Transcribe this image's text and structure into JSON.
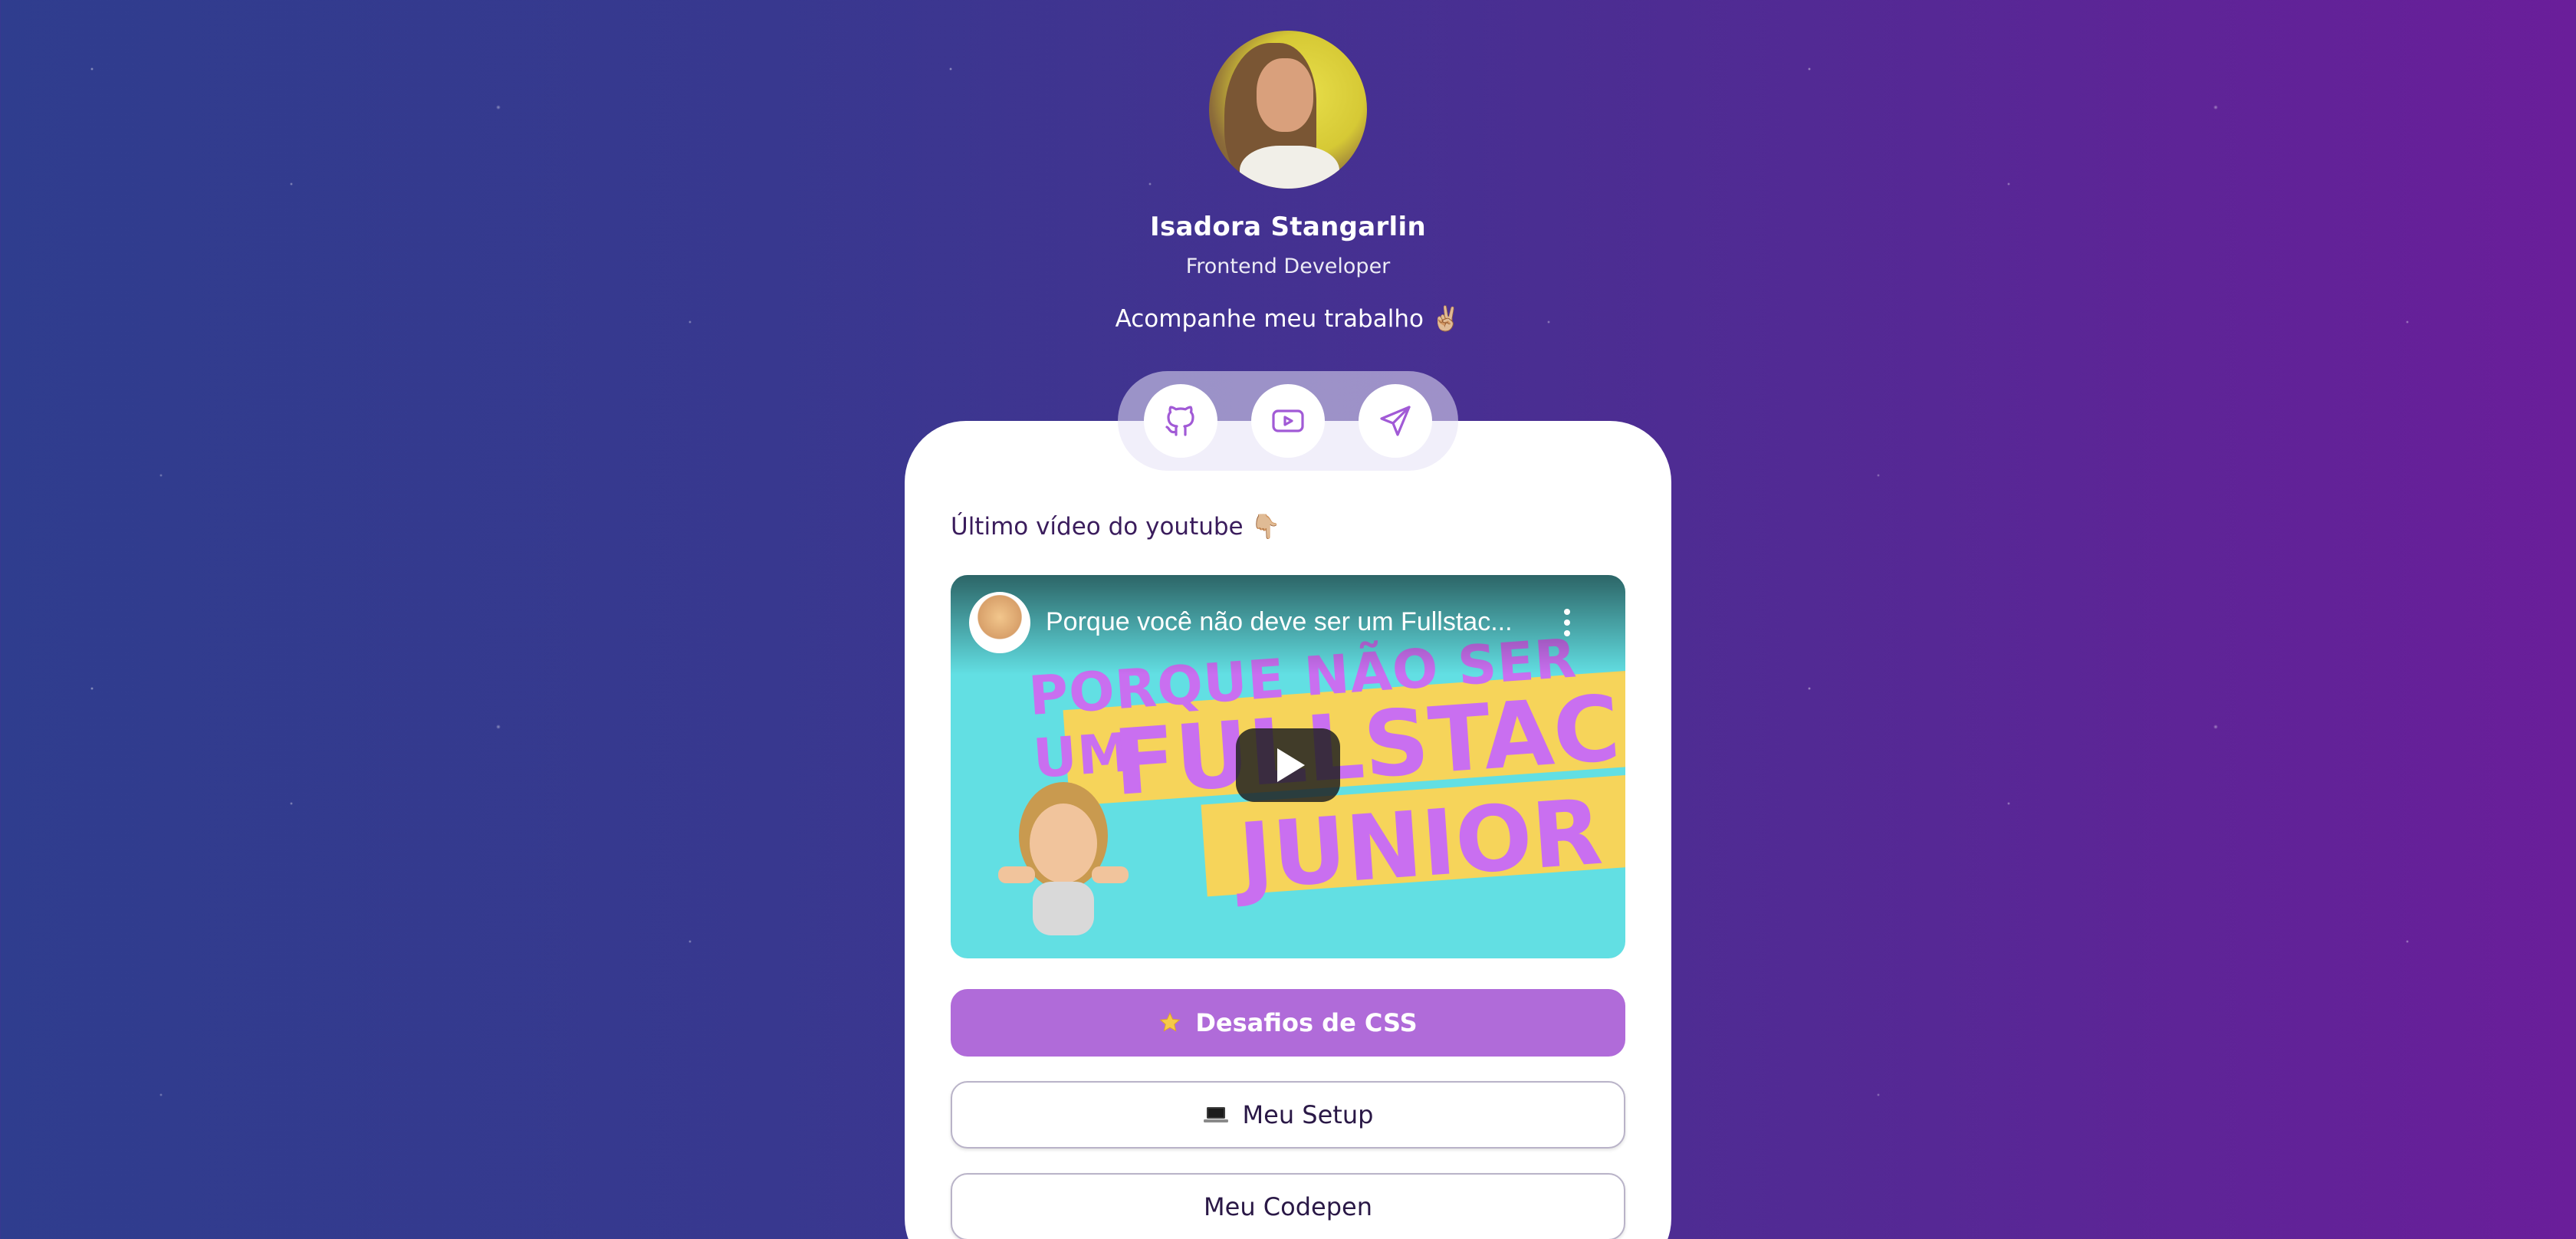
{
  "profile": {
    "name": "Isadora Stangarlin",
    "role": "Frontend Developer",
    "follow_text": "Acompanhe meu trabalho ✌🏼"
  },
  "social": [
    {
      "icon": "github-icon"
    },
    {
      "icon": "youtube-icon"
    },
    {
      "icon": "send-icon"
    }
  ],
  "section": {
    "title": "Último vídeo do youtube 👇🏼"
  },
  "video": {
    "title": "Porque você não deve ser um Fullstac...",
    "thumbnail_line1": "PORQUE NÃO SER UM",
    "thumbnail_line2": "FULLSTACK",
    "thumbnail_line3": "JUNIOR"
  },
  "links": {
    "css_challenges": "Desafios de CSS",
    "setup": "Meu Setup",
    "codepen": "Meu Codepen"
  },
  "colors": {
    "accent": "#b06bd9",
    "bg_left": "#2f3d8e",
    "bg_right": "#6a1e9a"
  }
}
